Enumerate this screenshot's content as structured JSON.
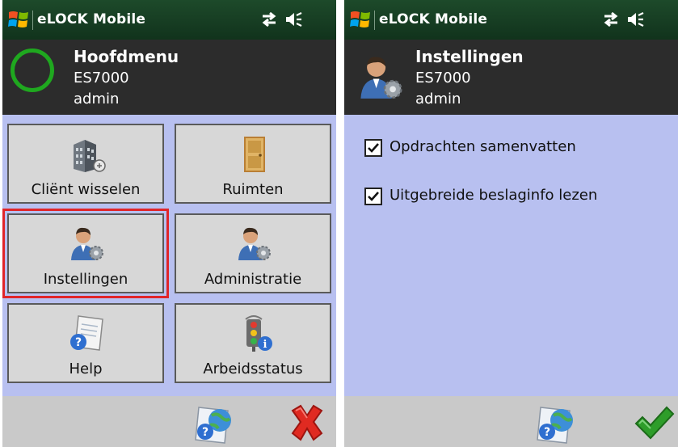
{
  "left_screen": {
    "title_bar": {
      "app_title": "eLOCK Mobile",
      "icons": [
        "windows-logo-icon",
        "connectivity-icon",
        "volume-icon"
      ]
    },
    "header": {
      "title": "Hoofdmenu",
      "device": "ES7000",
      "user": "admin",
      "status_icon": "status-circle-icon"
    },
    "tiles": [
      {
        "label": "Cliënt wisselen",
        "icon": "building-icon"
      },
      {
        "label": "Ruimten",
        "icon": "door-icon"
      },
      {
        "label": "Instellingen",
        "icon": "user-settings-icon",
        "selected": true
      },
      {
        "label": "Administratie",
        "icon": "user-settings-icon"
      },
      {
        "label": "Help",
        "icon": "help-icon"
      },
      {
        "label": "Arbeidsstatus",
        "icon": "traffic-light-info-icon"
      }
    ],
    "toolbar": {
      "help_icon": "help-globe-icon",
      "close_icon": "close-icon"
    }
  },
  "right_screen": {
    "title_bar": {
      "app_title": "eLOCK Mobile",
      "icons": [
        "windows-logo-icon",
        "connectivity-icon",
        "volume-icon"
      ]
    },
    "header": {
      "title": "Instellingen",
      "device": "ES7000",
      "user": "admin",
      "icon": "user-settings-icon"
    },
    "options": [
      {
        "label": "Opdrachten samenvatten",
        "checked": true
      },
      {
        "label": "Uitgebreide beslaginfo lezen",
        "checked": true
      }
    ],
    "toolbar": {
      "help_icon": "help-globe-icon",
      "ok_icon": "checkmark-icon"
    }
  },
  "colors": {
    "title_bar": "#163c22",
    "header": "#2c2c2c",
    "content": "#b8c0f0",
    "tile": "#d7d7d7",
    "toolbar": "#c9c9c9",
    "selection": "#e0252a",
    "status_ring": "#1fa81f"
  }
}
